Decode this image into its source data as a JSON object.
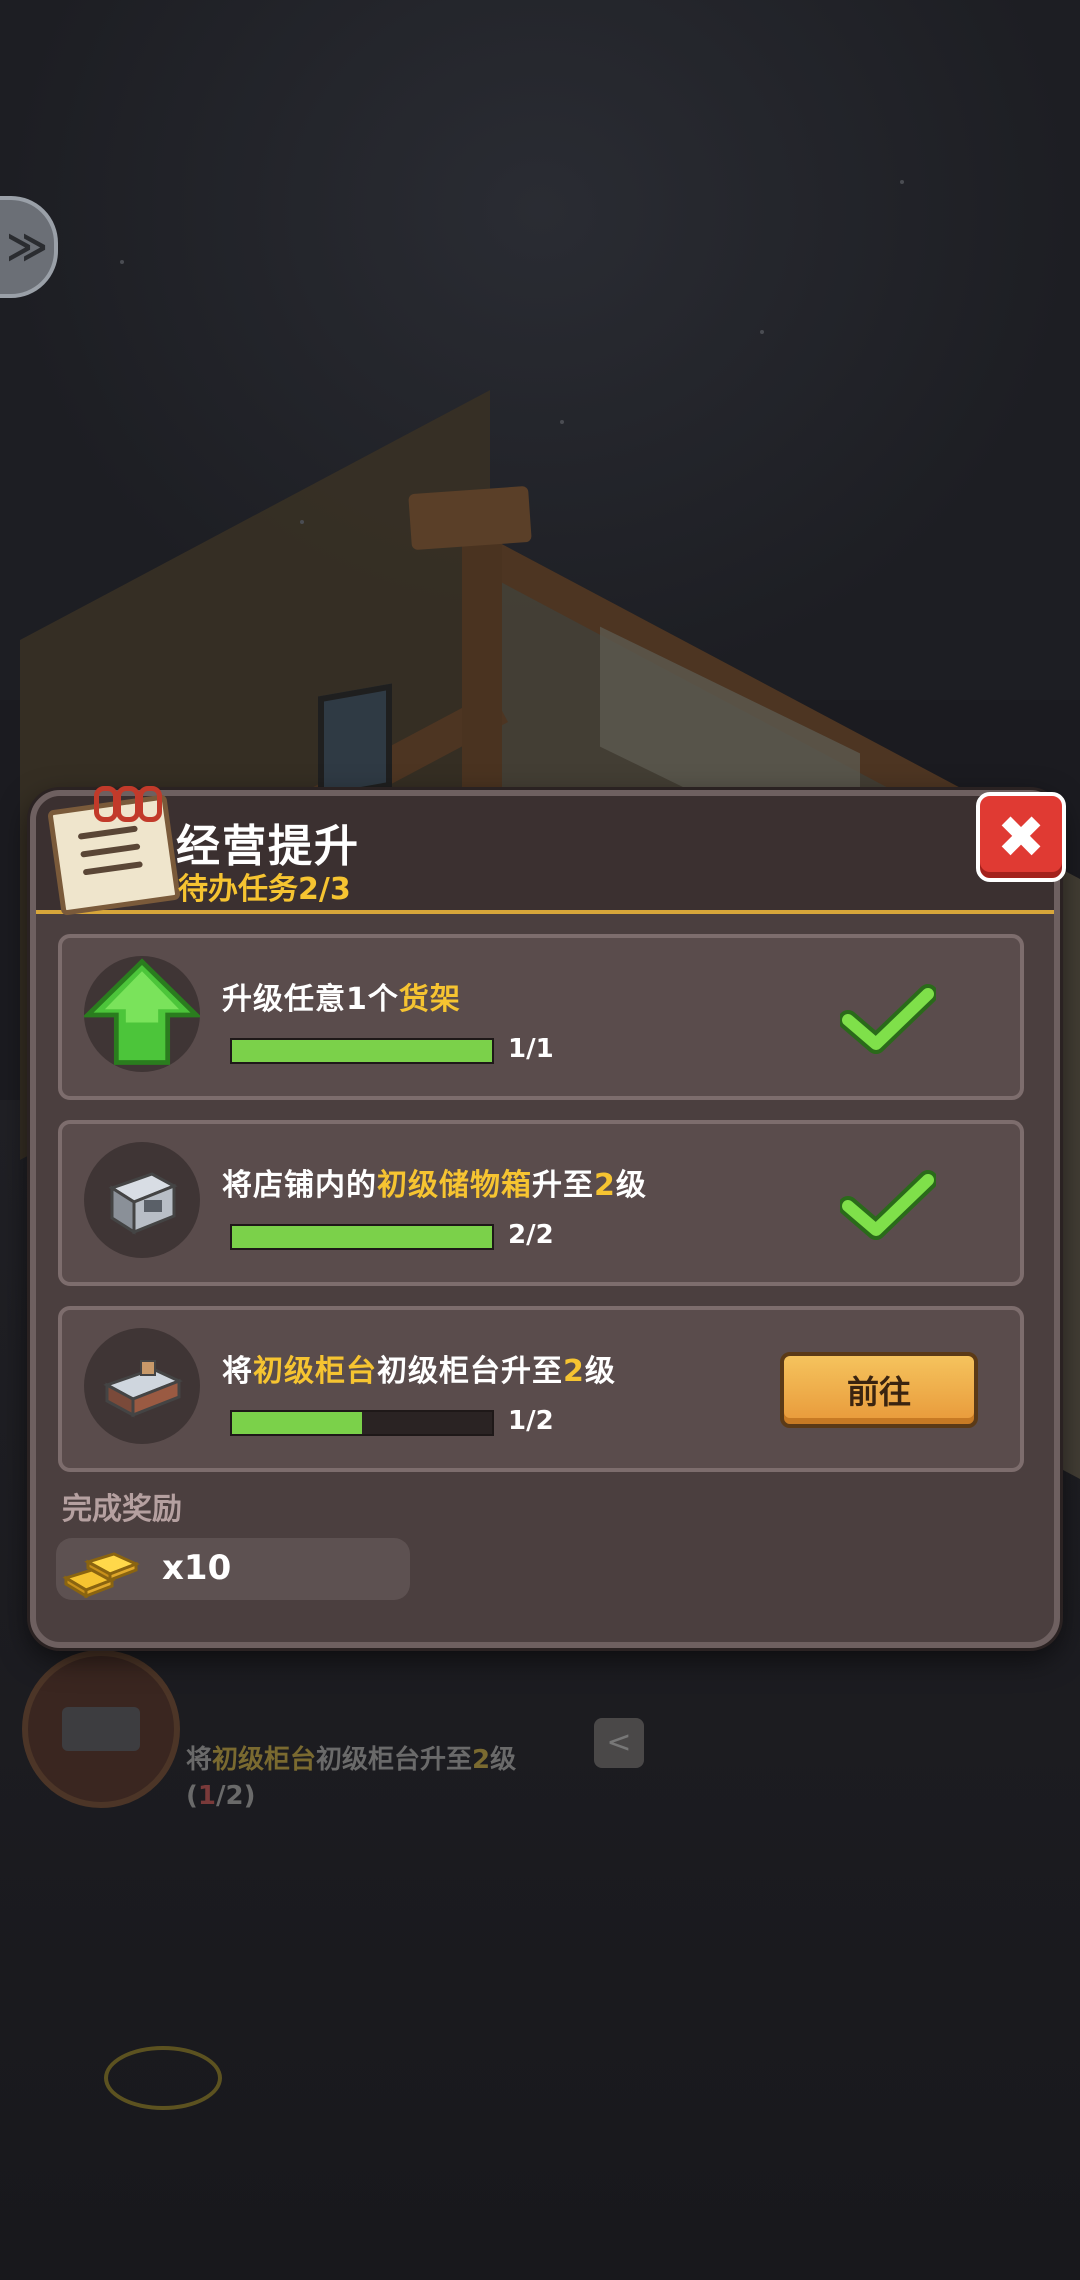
{
  "panel": {
    "title": "经营提升",
    "subtitle": "待办任务2/3",
    "close_label": "✖"
  },
  "tasks": [
    {
      "icon": "upgrade-arrow-icon",
      "desc_pre": "升级任意1个",
      "desc_hl": "货架",
      "desc_post": "",
      "progress": 1.0,
      "count": "1/1",
      "done": true
    },
    {
      "icon": "storage-box-icon",
      "desc_pre": "将店铺内的",
      "desc_hl": "初级储物箱",
      "desc_mid": "升至",
      "desc_num": "2",
      "desc_post": "级",
      "progress": 1.0,
      "count": "2/2",
      "done": true
    },
    {
      "icon": "counter-icon",
      "desc_pre": "将",
      "desc_hl": "初级柜台",
      "desc_mid": "初级柜台升至",
      "desc_num": "2",
      "desc_post": "级",
      "progress": 0.5,
      "count": "1/2",
      "done": false,
      "button": "前往"
    }
  ],
  "reward": {
    "label": "完成奖励",
    "icon": "gold-bars-icon",
    "qty": "x10"
  },
  "hint": {
    "pre": "将",
    "hl": "初级柜台",
    "mid": "初级柜台升至",
    "num": "2",
    "post": "级",
    "progress_open": "(",
    "progress_cur": "1",
    "progress_rest": "/2)",
    "back_label": "<"
  },
  "nav": {
    "label": "≫"
  },
  "colors": {
    "accent_gold": "#f6c431",
    "progress_green": "#7bd14a",
    "close_red": "#e03a33",
    "button_orange": "#e8993a"
  }
}
